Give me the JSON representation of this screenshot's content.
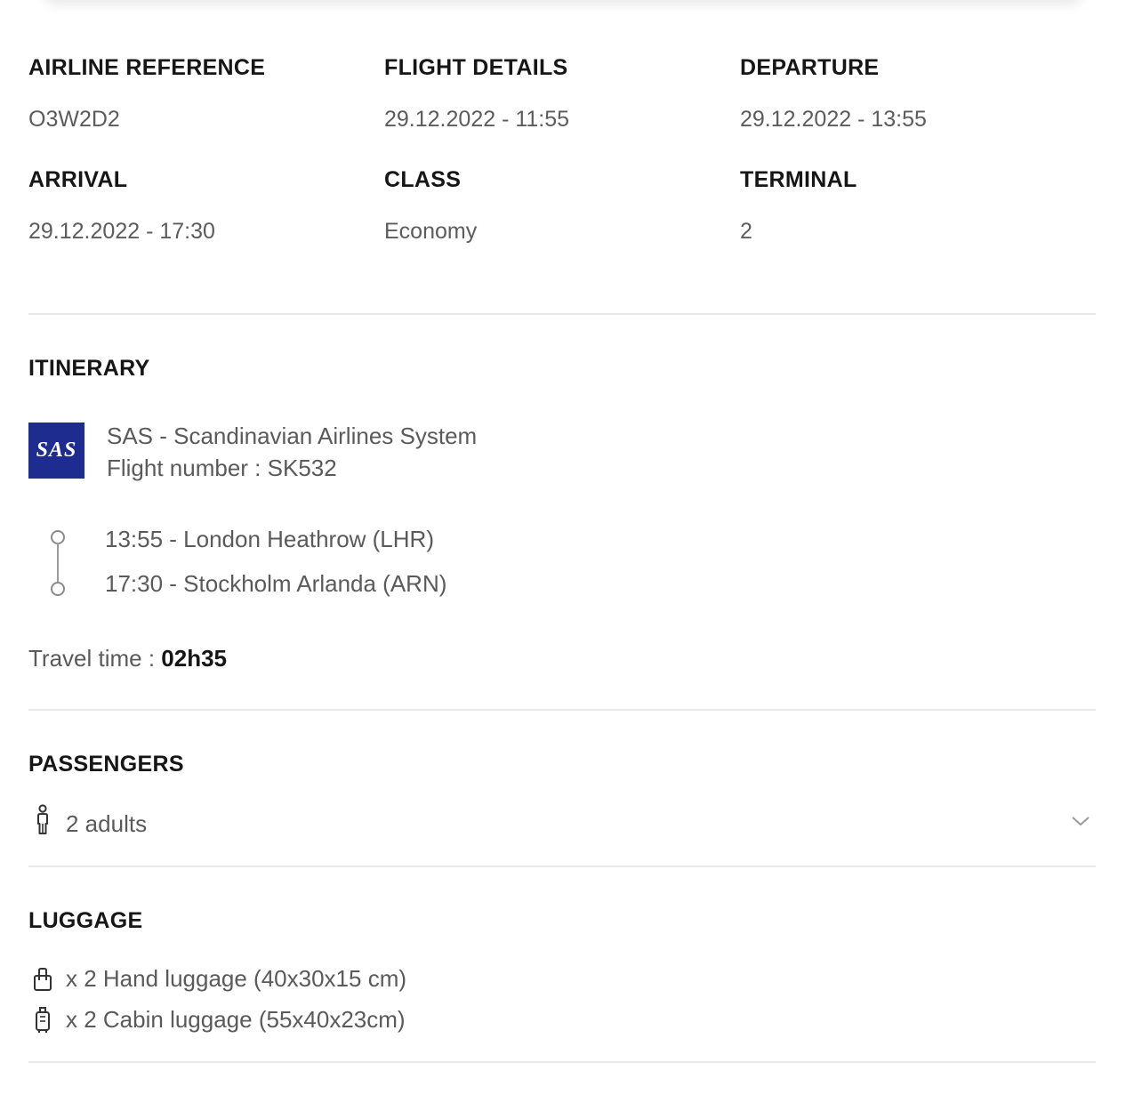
{
  "info": {
    "airline_reference": {
      "label": "AIRLINE REFERENCE",
      "value": "O3W2D2"
    },
    "flight_details": {
      "label": "FLIGHT DETAILS",
      "value": "29.12.2022 - 11:55"
    },
    "departure": {
      "label": "DEPARTURE",
      "value": "29.12.2022 - 13:55"
    },
    "arrival": {
      "label": "ARRIVAL",
      "value": "29.12.2022 - 17:30"
    },
    "class": {
      "label": "CLASS",
      "value": "Economy"
    },
    "terminal": {
      "label": "TERMINAL",
      "value": "2"
    }
  },
  "itinerary": {
    "title": "ITINERARY",
    "logo_text": "SAS",
    "logo_color": "#1f2c8f",
    "airline_name": "SAS - Scandinavian Airlines System",
    "flight_number": "Flight number : SK532",
    "departure_stop": "13:55 - London Heathrow (LHR)",
    "arrival_stop": "17:30 - Stockholm Arlanda (ARN)",
    "travel_time_label": "Travel time : ",
    "travel_time_value": "02h35"
  },
  "passengers": {
    "title": "PASSENGERS",
    "summary": "2 adults",
    "icon": "person-icon",
    "expand_icon": "chevron-down-icon"
  },
  "luggage": {
    "title": "LUGGAGE",
    "items": [
      {
        "icon": "hand-luggage-icon",
        "text": "x 2 Hand luggage (40x30x15 cm)"
      },
      {
        "icon": "cabin-luggage-icon",
        "text": "x 2 Cabin luggage (55x40x23cm)"
      }
    ]
  }
}
